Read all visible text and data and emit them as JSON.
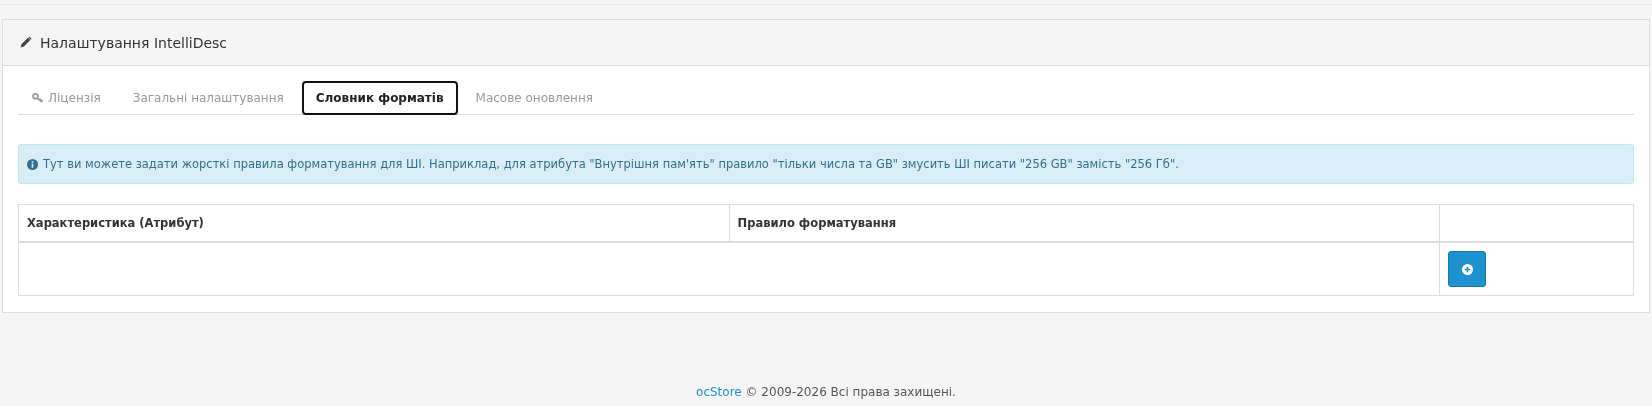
{
  "panel": {
    "title": "Налаштування IntelliDesc"
  },
  "tabs": [
    {
      "label": "Ліцензія",
      "selected": false
    },
    {
      "label": "Загальні налаштування",
      "selected": false
    },
    {
      "label": "Словник форматів",
      "selected": true
    },
    {
      "label": "Масове оновлення",
      "selected": false
    }
  ],
  "alert": {
    "text": "Тут ви можете задати жорсткі правила форматування для ШІ. Наприклад, для атрибута \"Внутрішня пам'ять\" правило \"тільки числа та GB\" змусить ШІ писати \"256 GB\" замість \"256 Гб\"."
  },
  "table": {
    "columns": [
      "Характеристика (Атрибут)",
      "Правило форматування"
    ]
  },
  "footer": {
    "link": "ocStore",
    "text": "© 2009-2026 Всі права захищені."
  }
}
